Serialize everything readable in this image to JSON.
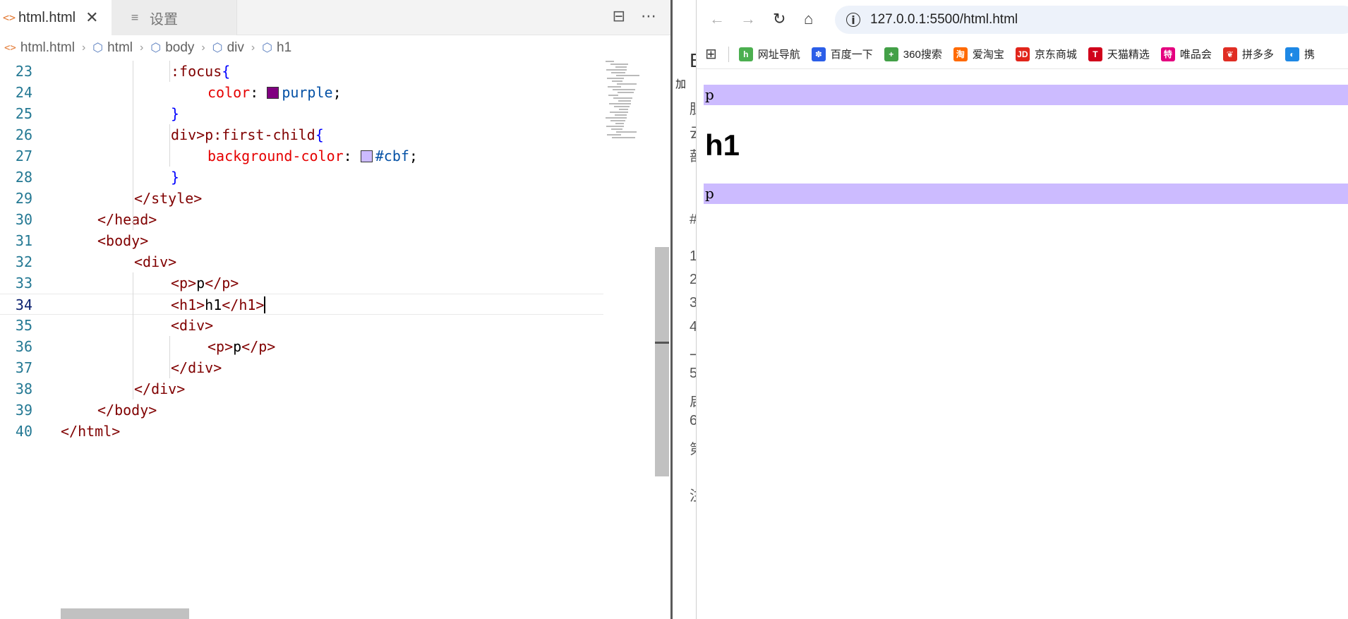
{
  "editor": {
    "tabs": [
      {
        "label": "html.html",
        "icon": "<>",
        "active": true,
        "close": "✕"
      },
      {
        "label": "设置",
        "icon": "≡",
        "active": false
      }
    ],
    "actions": [
      "⊟",
      "⋯"
    ],
    "breadcrumb": [
      "html.html",
      "html",
      "body",
      "div",
      "h1"
    ],
    "lines": [
      {
        "n": "23",
        "indent": 3,
        "html": "<span class=\"sel\">:focus</span><span class=\"brace\">{</span>"
      },
      {
        "n": "24",
        "indent": 4,
        "html": "<span class=\"prop\">color</span>: <span class=\"sw\" style=\"background:#800080\"></span><span class=\"val\">purple</span>;"
      },
      {
        "n": "25",
        "indent": 3,
        "html": "<span class=\"brace\">}</span>"
      },
      {
        "n": "26",
        "indent": 3,
        "html": "<span class=\"sel\">div&gt;p:first-child</span><span class=\"brace\">{</span>"
      },
      {
        "n": "27",
        "indent": 4,
        "html": "<span class=\"prop\">background-color</span>: <span class=\"sw\" style=\"background:#ccbbff\"></span><span class=\"val\">#cbf</span>;"
      },
      {
        "n": "28",
        "indent": 3,
        "html": "<span class=\"brace\">}</span>"
      },
      {
        "n": "29",
        "indent": 2,
        "html": "<span class=\"tag\">&lt;/style&gt;</span>"
      },
      {
        "n": "30",
        "indent": 1,
        "html": "<span class=\"tag\">&lt;/head&gt;</span>"
      },
      {
        "n": "31",
        "indent": 1,
        "html": "<span class=\"tag\">&lt;body&gt;</span>"
      },
      {
        "n": "32",
        "indent": 2,
        "html": "<span class=\"tag\">&lt;div&gt;</span>"
      },
      {
        "n": "33",
        "indent": 3,
        "html": "<span class=\"tag\">&lt;p&gt;</span>p<span class=\"tag\">&lt;/p&gt;</span>"
      },
      {
        "n": "34",
        "indent": 3,
        "html": "<span class=\"tag\">&lt;h1&gt;</span>h1<span class=\"tag\">&lt;/h1&gt;</span><span class=\"cursor\"></span>",
        "active": true
      },
      {
        "n": "35",
        "indent": 3,
        "html": "<span class=\"tag\">&lt;div&gt;</span>"
      },
      {
        "n": "36",
        "indent": 4,
        "html": "<span class=\"tag\">&lt;p&gt;</span>p<span class=\"tag\">&lt;/p&gt;</span>"
      },
      {
        "n": "37",
        "indent": 3,
        "html": "<span class=\"tag\">&lt;/div&gt;</span>"
      },
      {
        "n": "38",
        "indent": 2,
        "html": "<span class=\"tag\">&lt;/div&gt;</span>"
      },
      {
        "n": "39",
        "indent": 1,
        "html": "<span class=\"tag\">&lt;/body&gt;</span>"
      },
      {
        "n": "40",
        "indent": 0,
        "html": "<span class=\"tag\">&lt;/html&gt;</span>"
      }
    ]
  },
  "under_window": {
    "chars": [
      "B",
      "加",
      "肚",
      "云",
      "蔀",
      "#",
      "1",
      "2",
      "3",
      "4",
      "一",
      "5",
      "启",
      "6",
      "第",
      "注"
    ]
  },
  "browser": {
    "nav": {
      "back": "←",
      "forward": "→",
      "reload": "↻",
      "home": "⌂"
    },
    "site_info_icon": "i",
    "url": "127.0.0.1:5500/html.html",
    "apps_icon": "⊞",
    "bookmarks": [
      {
        "label": "网址导航",
        "icon": "h",
        "color": "#4caf50"
      },
      {
        "label": "百度一下",
        "icon": "✽",
        "color": "#2b5ee8"
      },
      {
        "label": "360搜索",
        "icon": "+",
        "color": "#43a047"
      },
      {
        "label": "爱淘宝",
        "icon": "淘",
        "color": "#ff6a00"
      },
      {
        "label": "京东商城",
        "icon": "JD",
        "color": "#e1251b"
      },
      {
        "label": "天猫精选",
        "icon": "T",
        "color": "#d0021b"
      },
      {
        "label": "唯品会",
        "icon": "特",
        "color": "#e4007f"
      },
      {
        "label": "拼多多",
        "icon": "❦",
        "color": "#e02e24"
      },
      {
        "label": "携",
        "icon": "◐",
        "color": "#1e88e5"
      }
    ],
    "render": {
      "p1": "p",
      "h1": "h1",
      "p2": "p",
      "highlight_color": "#ccbbff"
    }
  }
}
